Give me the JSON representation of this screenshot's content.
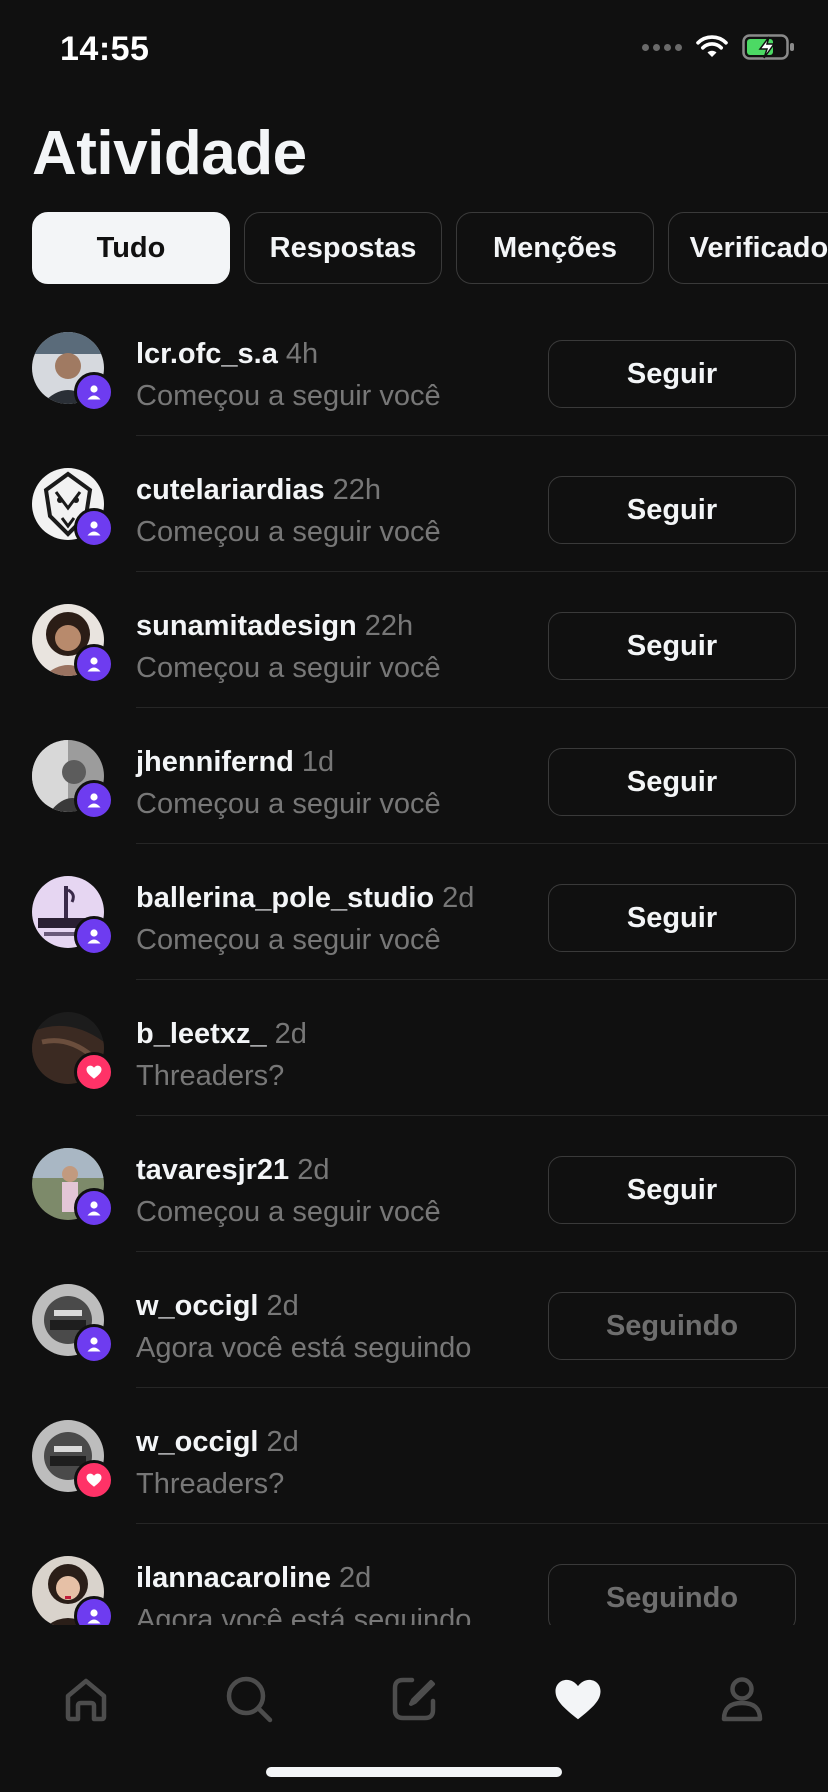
{
  "status_bar": {
    "time": "14:55"
  },
  "page": {
    "title": "Atividade"
  },
  "tabs": [
    {
      "label": "Tudo",
      "active": true
    },
    {
      "label": "Respostas",
      "active": false
    },
    {
      "label": "Menções",
      "active": false
    },
    {
      "label": "Verificados",
      "active": false
    }
  ],
  "activity": [
    {
      "username": "lcr.ofc_s.a",
      "time": "4h",
      "text": "Começou a seguir você",
      "badge": "follow",
      "button": "Seguir"
    },
    {
      "username": "cutelariardias",
      "time": "22h",
      "text": "Começou a seguir você",
      "badge": "follow",
      "button": "Seguir"
    },
    {
      "username": "sunamitadesign",
      "time": "22h",
      "text": "Começou a seguir você",
      "badge": "follow",
      "button": "Seguir"
    },
    {
      "username": "jhennifernd",
      "time": "1d",
      "text": "Começou a seguir você",
      "badge": "follow",
      "button": "Seguir"
    },
    {
      "username": "ballerina_pole_studio",
      "time": "2d",
      "text": "Começou a seguir você",
      "badge": "follow",
      "button": "Seguir"
    },
    {
      "username": "b_leetxz_",
      "time": "2d",
      "text": "Threaders?",
      "badge": "like",
      "button": ""
    },
    {
      "username": "tavaresjr21",
      "time": "2d",
      "text": "Começou a seguir você",
      "badge": "follow",
      "button": "Seguir"
    },
    {
      "username": "w_occigl",
      "time": "2d",
      "text": "Agora você está seguindo",
      "badge": "follow",
      "button": "Seguindo"
    },
    {
      "username": "w_occigl",
      "time": "2d",
      "text": "Threaders?",
      "badge": "like",
      "button": ""
    },
    {
      "username": "ilannacaroline",
      "time": "2d",
      "text": "Agora você está seguindo",
      "badge": "follow",
      "button": "Seguindo"
    }
  ],
  "nav": [
    {
      "icon": "home-icon",
      "active": false
    },
    {
      "icon": "search-icon",
      "active": false
    },
    {
      "icon": "compose-icon",
      "active": false
    },
    {
      "icon": "heart-icon",
      "active": true
    },
    {
      "icon": "profile-icon",
      "active": false
    }
  ],
  "colors": {
    "background": "#101010",
    "follow_badge": "#6e3cf0",
    "like_badge": "#ff3267",
    "muted_text": "#777777",
    "divider": "#262626"
  }
}
